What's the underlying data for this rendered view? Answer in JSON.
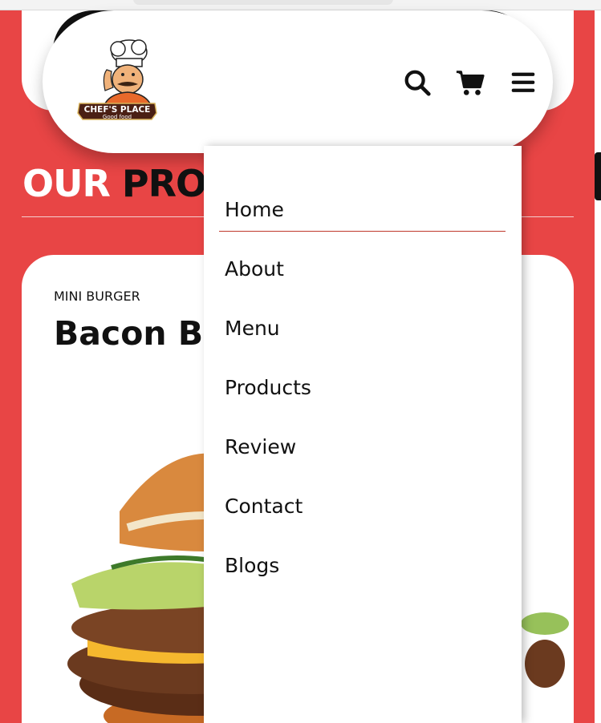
{
  "brand": {
    "name": "CHEF'S PLACE",
    "tagline": "Good food"
  },
  "header": {
    "icons": [
      "search-icon",
      "cart-icon",
      "hamburger-menu-icon"
    ]
  },
  "section": {
    "title_part1": "OUR",
    "title_part2": "PRO"
  },
  "product": {
    "kicker": "MINI BURGER",
    "name": "Bacon B"
  },
  "menu": {
    "items": [
      {
        "label": "Home",
        "active": true
      },
      {
        "label": "About"
      },
      {
        "label": "Menu"
      },
      {
        "label": "Products"
      },
      {
        "label": "Review"
      },
      {
        "label": "Contact"
      },
      {
        "label": "Blogs"
      }
    ]
  },
  "colors": {
    "accent_red": "#e84545",
    "active_underline": "#c0392b",
    "text_dark": "#111111"
  }
}
